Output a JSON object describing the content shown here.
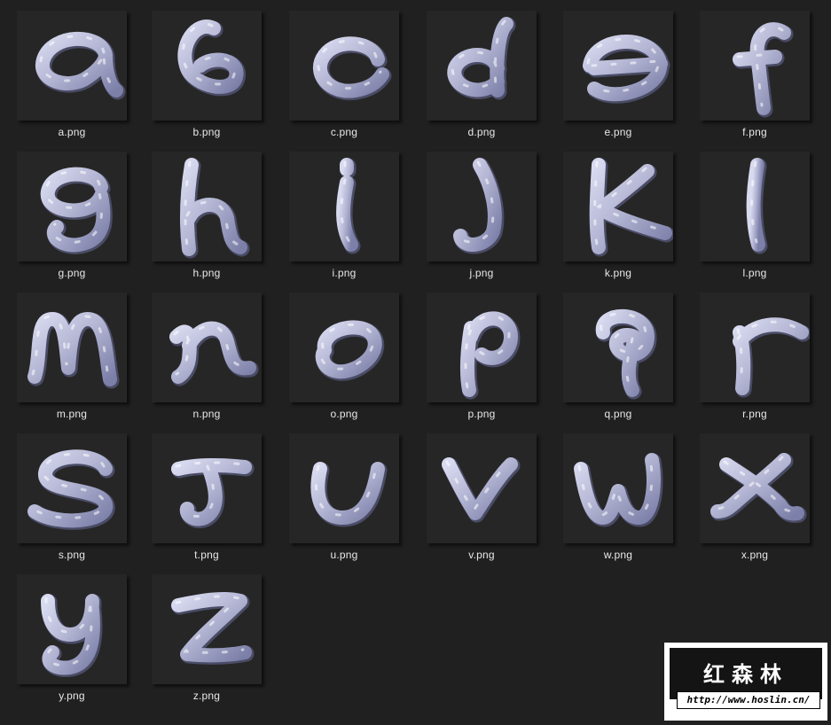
{
  "files": [
    {
      "name": "a.png",
      "glyph": "a"
    },
    {
      "name": "b.png",
      "glyph": "b"
    },
    {
      "name": "c.png",
      "glyph": "c"
    },
    {
      "name": "d.png",
      "glyph": "d"
    },
    {
      "name": "e.png",
      "glyph": "e"
    },
    {
      "name": "f.png",
      "glyph": "f"
    },
    {
      "name": "g.png",
      "glyph": "g"
    },
    {
      "name": "h.png",
      "glyph": "h"
    },
    {
      "name": "i.png",
      "glyph": "i"
    },
    {
      "name": "j.png",
      "glyph": "j"
    },
    {
      "name": "k.png",
      "glyph": "k"
    },
    {
      "name": "l.png",
      "glyph": "l"
    },
    {
      "name": "m.png",
      "glyph": "m"
    },
    {
      "name": "n.png",
      "glyph": "n"
    },
    {
      "name": "o.png",
      "glyph": "o"
    },
    {
      "name": "p.png",
      "glyph": "p"
    },
    {
      "name": "q.png",
      "glyph": "q"
    },
    {
      "name": "r.png",
      "glyph": "r"
    },
    {
      "name": "s.png",
      "glyph": "s"
    },
    {
      "name": "t.png",
      "glyph": "t"
    },
    {
      "name": "u.png",
      "glyph": "u"
    },
    {
      "name": "v.png",
      "glyph": "v"
    },
    {
      "name": "w.png",
      "glyph": "w"
    },
    {
      "name": "x.png",
      "glyph": "x"
    },
    {
      "name": "y.png",
      "glyph": "y"
    },
    {
      "name": "z.png",
      "glyph": "z"
    }
  ],
  "watermark": {
    "brand": "红森林",
    "url": "http://www.hoslin.cn/"
  },
  "colors": {
    "background": "#202020",
    "thumb_background": "#262626",
    "label_text": "#e8e8e8",
    "glyph_fill": "#b4b6d4",
    "glyph_highlight": "#ffffff"
  }
}
